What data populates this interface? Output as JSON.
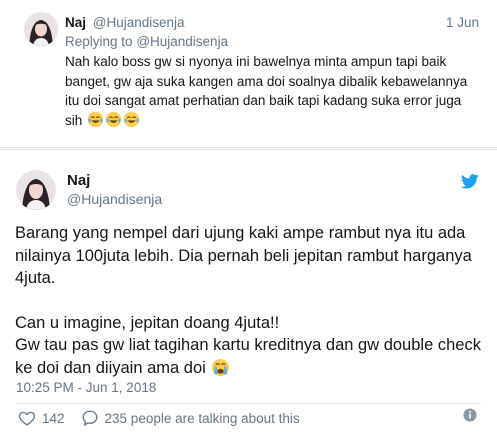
{
  "reply": {
    "name": "Naj",
    "handle": "@Hujandisenja",
    "date": "1 Jun",
    "replying_prefix": "Replying to",
    "replying_handle": "@Hujandisenja",
    "text": "Nah kalo boss gw si nyonya ini bawelnya minta ampun tapi baik banget, gw aja suka kangen ama doi soalnya dibalik kebawelannya itu doi sangat amat perhatian dan baik tapi kadang suka error juga sih",
    "emoji_icons": [
      "laughing-tears-emoji",
      "laughing-tears-emoji",
      "laughing-tears-emoji"
    ]
  },
  "tweet": {
    "name": "Naj",
    "handle": "@Hujandisenja",
    "paragraph_1": "Barang yang nempel dari ujung kaki ampe rambut nya itu ada nilainya 100juta lebih. Dia pernah beli jepitan rambut harganya 4juta.",
    "paragraph_2_line_1": "Can u imagine, jepitan doang 4juta!!",
    "paragraph_2_line_2": "Gw tau pas gw liat tagihan kartu kreditnya dan gw double check ke doi dan diiyain ama doi",
    "emoji_icon": "crying-face-emoji",
    "timestamp": "10:25 PM - Jun 1, 2018",
    "like_count": "142",
    "talking_label": "235 people are talking about this",
    "brand_icon": "twitter-bird-icon",
    "brand_color": "#1da1f2"
  }
}
